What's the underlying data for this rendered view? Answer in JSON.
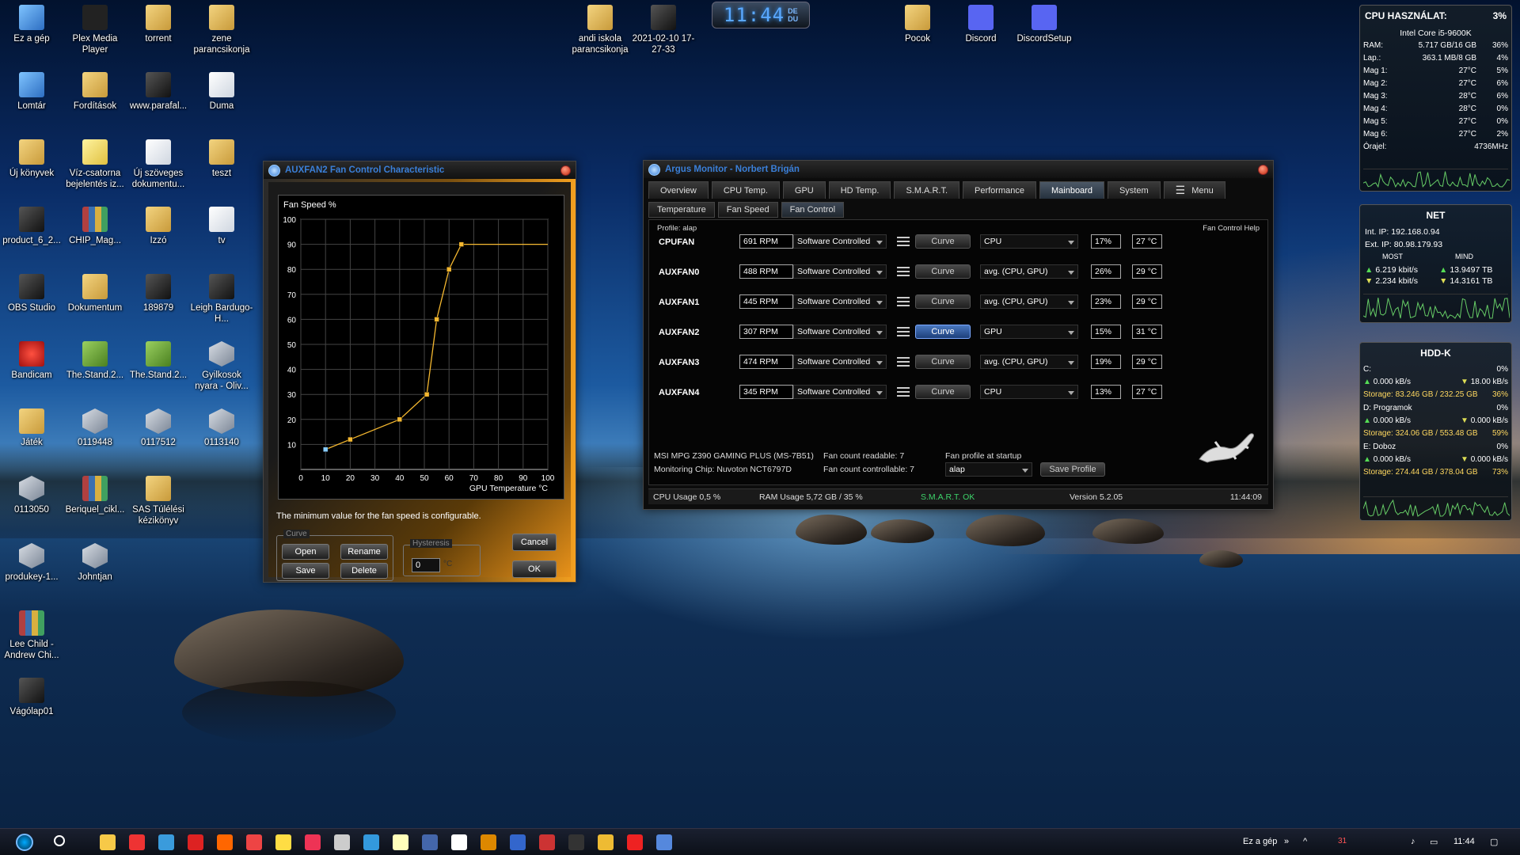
{
  "clock": {
    "time": "11:44",
    "ampm_top": "DE",
    "ampm_bottom": "DU"
  },
  "desktop_icons": [
    {
      "label": "Ez a gép",
      "icon": "pc"
    },
    {
      "label": "Plex Media Player",
      "icon": "plex"
    },
    {
      "label": "torrent",
      "icon": "folder"
    },
    {
      "label": "zene parancsikonja",
      "icon": "folder"
    },
    {
      "label": "Lomtár",
      "icon": "pc"
    },
    {
      "label": "Fordítások",
      "icon": "folder"
    },
    {
      "label": "www.parafal...",
      "icon": "dark"
    },
    {
      "label": "Duma",
      "icon": "doc"
    },
    {
      "label": "Új könyvek",
      "icon": "folder"
    },
    {
      "label": "Víz-csatorna bejelentés iz...",
      "icon": "yellow"
    },
    {
      "label": "Új szöveges dokumentu...",
      "icon": "doc"
    },
    {
      "label": "teszt",
      "icon": "folder"
    },
    {
      "label": "product_6_2...",
      "icon": "dark"
    },
    {
      "label": "CHIP_Mag...",
      "icon": "books"
    },
    {
      "label": "Izzó",
      "icon": "folder"
    },
    {
      "label": "tv",
      "icon": "doc"
    },
    {
      "label": "OBS Studio",
      "icon": "dark"
    },
    {
      "label": "Dokumentum",
      "icon": "folder"
    },
    {
      "label": "189879",
      "icon": "dark"
    },
    {
      "label": "Leigh Bardugo-H...",
      "icon": "dark"
    },
    {
      "label": "Bandicam",
      "icon": "red"
    },
    {
      "label": "The.Stand.2...",
      "icon": "green"
    },
    {
      "label": "The.Stand.2...",
      "icon": "green"
    },
    {
      "label": "Gyilkosok nyara - Oliv...",
      "icon": "cube"
    },
    {
      "label": "Játék",
      "icon": "folder"
    },
    {
      "label": "0119448",
      "icon": "cube"
    },
    {
      "label": "0117512",
      "icon": "cube"
    },
    {
      "label": "0113140",
      "icon": "cube"
    },
    {
      "label": "0113050",
      "icon": "cube"
    },
    {
      "label": "Beriquel_cikl...",
      "icon": "books"
    },
    {
      "label": "SAS Túlélési kézikönyv",
      "icon": "folder"
    },
    {
      "label": "produkey-1...",
      "icon": "cube"
    },
    {
      "label": "Johntjan",
      "icon": "cube"
    },
    {
      "label": "Lee Child - Andrew Chi...",
      "icon": "books"
    },
    {
      "label": "Vágólap01",
      "icon": "dark"
    },
    {
      "label": "andi iskola parancsikonja",
      "icon": "folder"
    },
    {
      "label": "2021-02-10 17-27-33",
      "icon": "dark"
    },
    {
      "label": "Pocok",
      "icon": "folder"
    },
    {
      "label": "Discord",
      "icon": "discord"
    },
    {
      "label": "DiscordSetup",
      "icon": "discord"
    }
  ],
  "fan_window": {
    "title": "AUXFAN2 Fan Control Characteristic",
    "note": "The minimum value for the fan speed is configurable.",
    "curve_group": "Curve",
    "open": "Open",
    "rename": "Rename",
    "save": "Save",
    "delete": "Delete",
    "hysteresis_group": "Hysteresis",
    "hysteresis_value": "0",
    "hysteresis_unit": "°C",
    "cancel": "Cancel",
    "ok": "OK"
  },
  "chart_data": {
    "type": "line",
    "title": "Fan Speed %",
    "xlabel": "GPU Temperature °C",
    "ylabel": "Fan Speed %",
    "x_ticks": [
      0,
      10,
      20,
      30,
      40,
      50,
      60,
      70,
      80,
      90,
      100
    ],
    "y_ticks": [
      10,
      20,
      30,
      40,
      50,
      60,
      70,
      80,
      90,
      100
    ],
    "xlim": [
      0,
      100
    ],
    "ylim": [
      0,
      100
    ],
    "grid": true,
    "series": [
      {
        "x": [
          10,
          20,
          40,
          51,
          55,
          60,
          65,
          100
        ],
        "y": [
          8,
          12,
          20,
          30,
          60,
          80,
          90,
          90
        ]
      }
    ]
  },
  "argus": {
    "title": "Argus Monitor - Norbert Brigán",
    "tabs": [
      "Overview",
      "CPU Temp.",
      "GPU",
      "HD Temp.",
      "S.M.A.R.T.",
      "Performance",
      "Mainboard",
      "System"
    ],
    "active_tab": "Mainboard",
    "menu_label": "Menu",
    "subtabs": [
      "Temperature",
      "Fan Speed",
      "Fan Control"
    ],
    "active_subtab": "Fan Control",
    "profile": "Profile: alap",
    "help": "Fan Control Help",
    "curve_label": "Curve",
    "fans": [
      {
        "name": "CPUFAN",
        "rpm": "691 RPM",
        "mode": "Software Controlled",
        "source": "CPU",
        "pct": "17%",
        "temp": "27 °C"
      },
      {
        "name": "AUXFAN0",
        "rpm": "488 RPM",
        "mode": "Software Controlled",
        "source": "avg. (CPU, GPU)",
        "pct": "26%",
        "temp": "29 °C"
      },
      {
        "name": "AUXFAN1",
        "rpm": "445 RPM",
        "mode": "Software Controlled",
        "source": "avg. (CPU, GPU)",
        "pct": "23%",
        "temp": "29 °C"
      },
      {
        "name": "AUXFAN2",
        "rpm": "307 RPM",
        "mode": "Software Controlled",
        "source": "GPU",
        "pct": "15%",
        "temp": "31 °C"
      },
      {
        "name": "AUXFAN3",
        "rpm": "474 RPM",
        "mode": "Software Controlled",
        "source": "avg. (CPU, GPU)",
        "pct": "19%",
        "temp": "29 °C"
      },
      {
        "name": "AUXFAN4",
        "rpm": "345 RPM",
        "mode": "Software Controlled",
        "source": "CPU",
        "pct": "13%",
        "temp": "27 °C"
      }
    ],
    "board": "MSI MPG Z390 GAMING PLUS (MS-7B51)",
    "chip": "Monitoring Chip: Nuvoton NCT6797D",
    "fan_readable": "Fan count readable: 7",
    "fan_controllable": "Fan count controllable: 7",
    "profile_startup": "Fan profile at startup",
    "profile_value": "alap",
    "save_profile": "Save Profile",
    "status": {
      "cpu": "CPU Usage 0,5 %",
      "ram": "RAM Usage 5,72 GB / 35 %",
      "smart": "S.M.A.R.T. OK",
      "version": "Version 5.2.05",
      "time": "11:44:09"
    }
  },
  "cpu_gadget": {
    "title": "CPU HASZNÁLAT:",
    "title_value": "3%",
    "model": "Intel Core i5-9600K",
    "rows": [
      {
        "label": "RAM:",
        "mid": "5.717 GB/16 GB",
        "val": "36%"
      },
      {
        "label": "Lap.:",
        "mid": "363.1 MB/8 GB",
        "val": "4%"
      },
      {
        "label": "Mag 1:",
        "mid": "27°C",
        "val": "5%"
      },
      {
        "label": "Mag 2:",
        "mid": "27°C",
        "val": "6%"
      },
      {
        "label": "Mag 3:",
        "mid": "28°C",
        "val": "6%"
      },
      {
        "label": "Mag 4:",
        "mid": "28°C",
        "val": "0%"
      },
      {
        "label": "Mag 5:",
        "mid": "27°C",
        "val": "0%"
      },
      {
        "label": "Mag 6:",
        "mid": "27°C",
        "val": "2%"
      },
      {
        "label": "Órajel:",
        "mid": "",
        "val": "4736MHz"
      }
    ]
  },
  "net_gadget": {
    "title": "NET",
    "int_ip": "Int. IP:  192.168.0.94",
    "ext_ip": "Ext. IP: 80.98.179.93",
    "most": "MOST",
    "mind": "MIND",
    "up_now": "6.219 kbit/s",
    "down_now": "2.234 kbit/s",
    "up_total": "13.9497 TB",
    "down_total": "14.3161 TB"
  },
  "hdd_gadget": {
    "title": "HDD-K",
    "drives": [
      {
        "name": "C:",
        "pct": "0%",
        "read": "0.000 kB/s",
        "write": "18.00 kB/s",
        "storage": "Storage: 83.246 GB / 232.25 GB",
        "used": "36%"
      },
      {
        "name": "D: Programok",
        "pct": "0%",
        "read": "0.000 kB/s",
        "write": "0.000 kB/s",
        "storage": "Storage: 324.06 GB / 553.48 GB",
        "used": "59%"
      },
      {
        "name": "E: Doboz",
        "pct": "0%",
        "read": "0.000 kB/s",
        "write": "0.000 kB/s",
        "storage": "Storage: 274.44 GB / 378.04 GB",
        "used": "73%"
      }
    ]
  },
  "taskbar": {
    "ez_a_gep": "Ez a gép",
    "time": "11:44",
    "badge": "31"
  }
}
